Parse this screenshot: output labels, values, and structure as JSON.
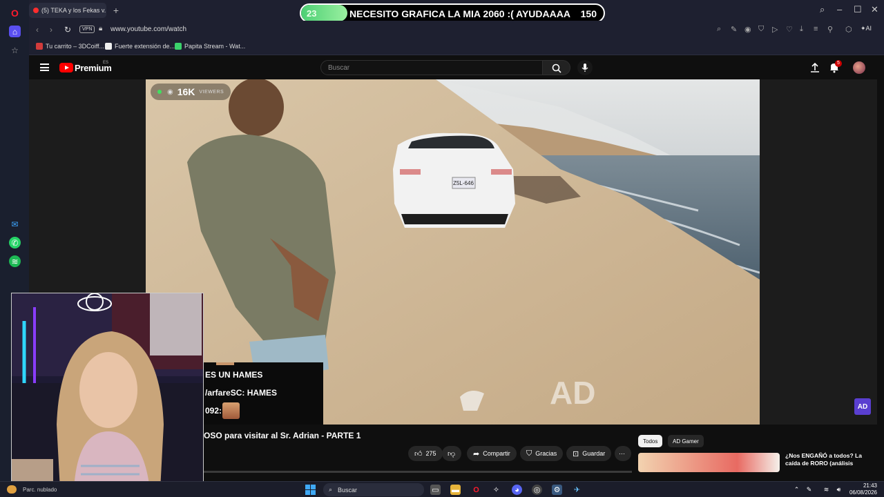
{
  "overlay": {
    "goal_current": "23",
    "goal_text": "NECESITO GRAFICA LA MIA 2060 :( AYUDAAAA",
    "goal_target": "150",
    "goal_fraction": 0.153
  },
  "browser": {
    "tab_title": "(5) TEKA y los Fekas v...",
    "url": "www.youtube.com/watch",
    "vpn_label": "VPN",
    "bookmarks": [
      {
        "label": "Tu carrito – 3DCoiff...",
        "icon_color": "#d23b3b"
      },
      {
        "label": "Fuerte extensión de...",
        "icon_color": "#ffffff"
      },
      {
        "label": "Papita Stream - Wat...",
        "icon_color": "#3bd26b"
      }
    ],
    "ai_label": "AI",
    "accent": "#ff1b2d"
  },
  "youtube": {
    "brand": "Premium",
    "country": "ES",
    "search_placeholder": "Buscar",
    "notification_count": "5",
    "viewer_count": "16K",
    "viewer_label": "VIEWERS",
    "title": "OSO para visitar al Sr. Adrian - PARTE 1",
    "like_count": "275",
    "actions": {
      "share": "Compartir",
      "thanks": "Gracias",
      "save": "Guardar"
    },
    "chips": [
      "Todos",
      "AD Gamer"
    ],
    "recommendation_title": "¿Nos ENGAÑÓ a todos? La caída de RORO (análisis",
    "watermark": "AD",
    "plate": "Z5L-646"
  },
  "chat": {
    "lines": [
      "ES UN HAMES",
      "/arfareSC: HAMES",
      "092:"
    ]
  },
  "taskbar": {
    "weather": "Parc. nublado",
    "search_label": "Buscar",
    "time": "21:43",
    "date": "06/08/2026"
  }
}
